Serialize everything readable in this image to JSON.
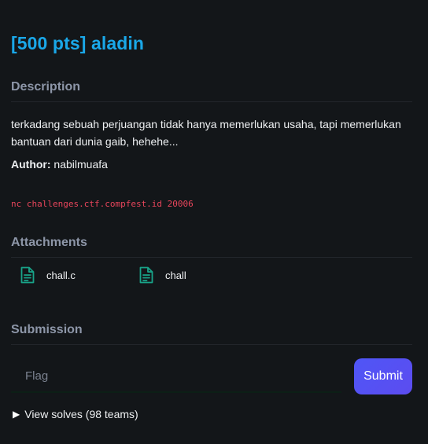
{
  "challenge": {
    "title": "[500 pts] aladin"
  },
  "description": {
    "heading": "Description",
    "text": "terkadang sebuah perjuangan tidak hanya memerlukan usaha, tapi memerlukan bantuan dari dunia gaib, hehehe...",
    "author_label": "Author:",
    "author_name": " nabilmuafa",
    "command": "nc challenges.ctf.compfest.id 20006"
  },
  "attachments": {
    "heading": "Attachments",
    "files": [
      {
        "name": "chall.c",
        "icon": "file-icon"
      },
      {
        "name": "chall",
        "icon": "file-icon"
      }
    ]
  },
  "submission": {
    "heading": "Submission",
    "flag_placeholder": "Flag",
    "flag_value": "",
    "submit_label": "Submit"
  },
  "solves": {
    "toggle_icon": "triangle-right-icon",
    "label": "View solves (98 teams)"
  },
  "colors": {
    "background": "#131619",
    "title": "#1aa7e8",
    "section_heading": "#8d96a8",
    "command": "#e8455b",
    "file_icon": "#19a489",
    "submit_button": "#5151f4"
  }
}
